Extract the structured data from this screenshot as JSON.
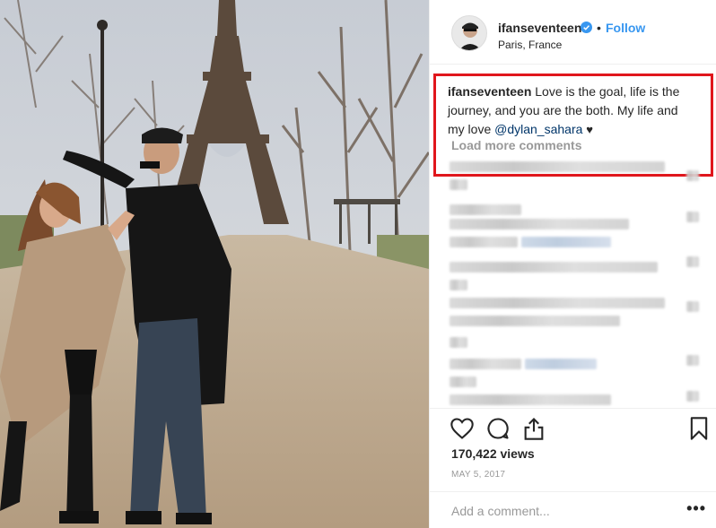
{
  "post": {
    "image_alt": "Couple dancing on a gravel path near the Eiffel Tower"
  },
  "header": {
    "username": "ifanseventeen",
    "verified": true,
    "dot": "•",
    "follow_label": "Follow",
    "location": "Paris, France"
  },
  "caption": {
    "username": "ifanseventeen",
    "text": "Love is the goal, life is the journey, and you are the both. My life and my love",
    "mention": "@dylan_sahara",
    "heart": "♥"
  },
  "comments": {
    "load_more_label": "Load more comments"
  },
  "actions": {
    "like_icon": "heart-outline-icon",
    "comment_icon": "speech-bubble-icon",
    "share_icon": "share-icon",
    "save_icon": "bookmark-icon"
  },
  "stats": {
    "views": "170,422 views",
    "date": "MAY 5, 2017"
  },
  "comment_box": {
    "placeholder": "Add a comment...",
    "more_label": "•••"
  },
  "colors": {
    "follow_blue": "#3897f0",
    "highlight_red": "#e0161c",
    "mention_blue": "#003569",
    "muted_gray": "#999999"
  }
}
